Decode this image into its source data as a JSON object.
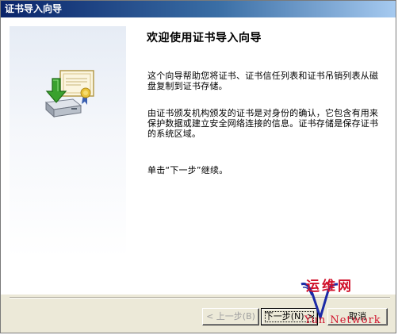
{
  "window": {
    "title": "证书导入向导"
  },
  "wizard": {
    "heading": "欢迎使用证书导入向导",
    "paragraph_1": "这个向导帮助您将证书、证书信任列表和证书吊销列表从磁盘复制到证书存储。",
    "paragraph_2": "由证书颁发机构颁发的证书是对身份的确认，它包含有用来保护数据或建立安全网络连接的信息。证书存储是保存证书的系统区域。",
    "paragraph_3": "单击“下一步”继续。",
    "icon": "certificate-import-icon"
  },
  "buttons": {
    "back_label": "< 上一步(B)",
    "next_label": "下一步(N) >",
    "cancel_label": "取消"
  },
  "watermark": {
    "top_text": "运维网",
    "bottom_text": "Yun Network"
  },
  "colors": {
    "titlebar_start": "#0a246a",
    "titlebar_end": "#a6caf0",
    "dialog_background": "#ece9d8",
    "watermark_red": "#d0102a",
    "watermark_blue": "#1b2aa6"
  }
}
